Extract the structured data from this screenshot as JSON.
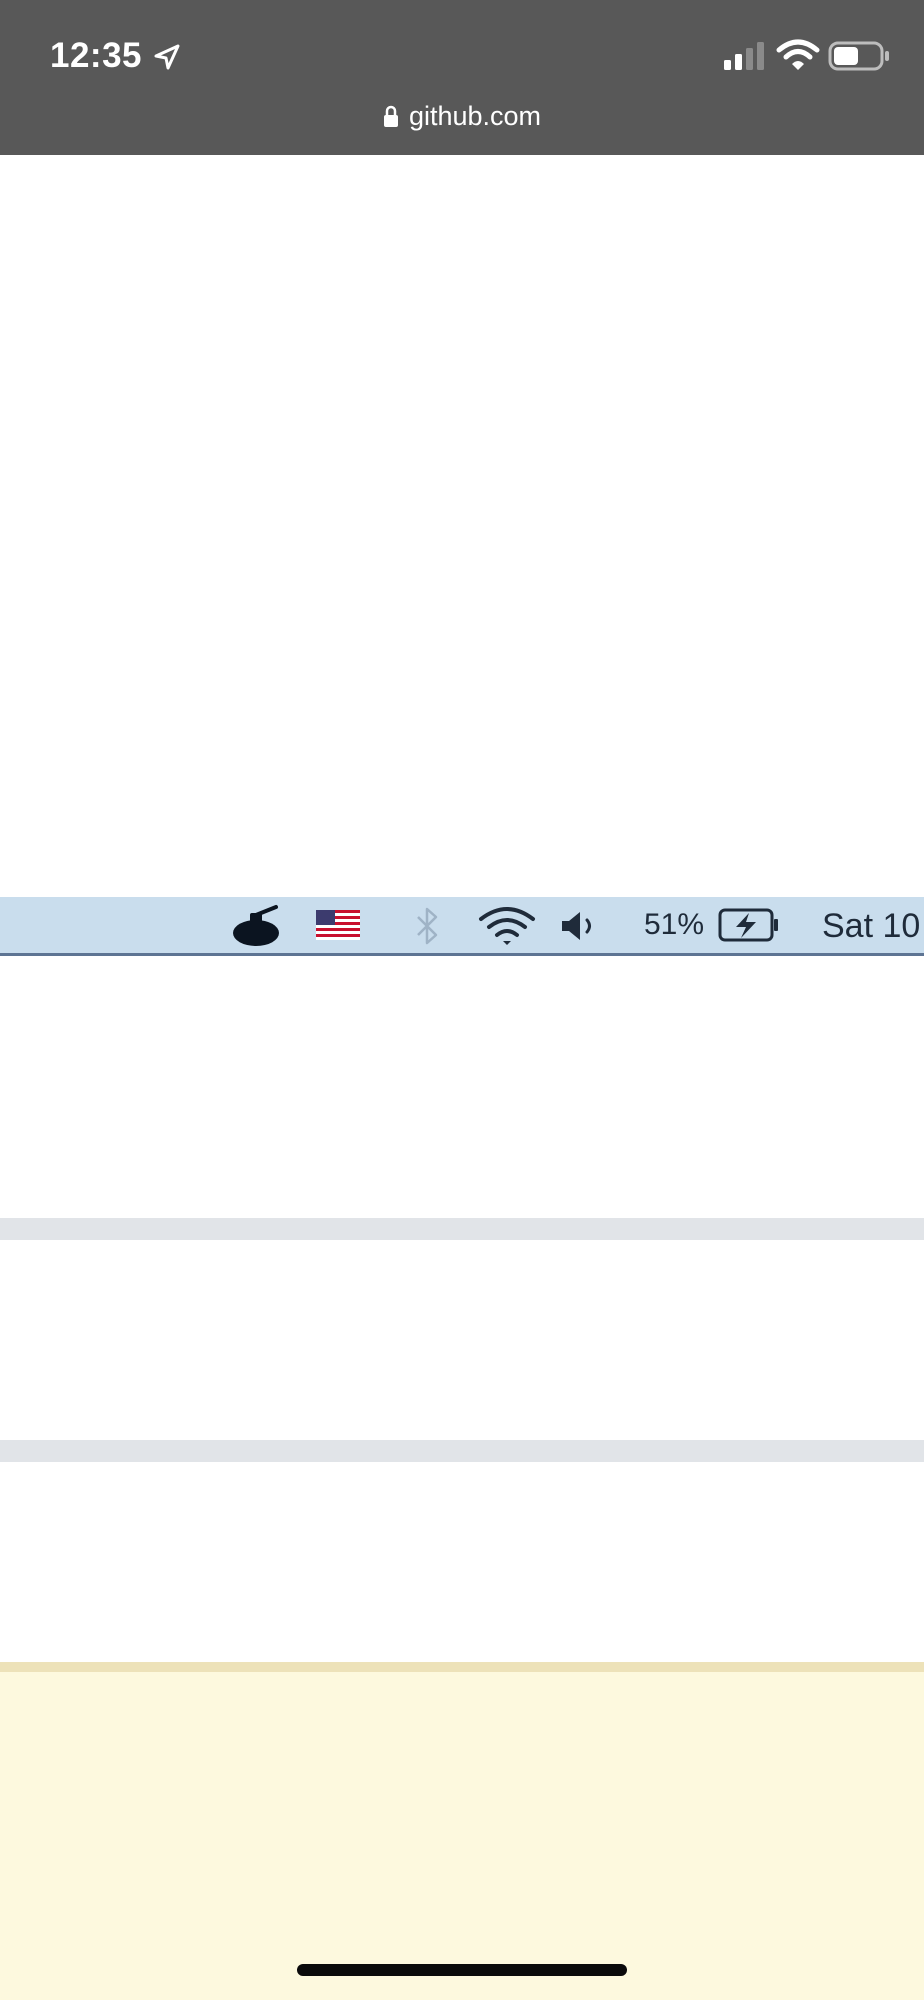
{
  "status_bar": {
    "time": "12:35",
    "icons": [
      "location-arrow-icon",
      "cellular-signal-icon",
      "wifi-icon",
      "battery-icon"
    ]
  },
  "browser": {
    "url": "github.com",
    "icons": [
      "lock-icon"
    ]
  },
  "mac_menubar": {
    "icons": [
      "app-icon",
      "us-flag-icon",
      "bluetooth-icon",
      "wifi-icon",
      "volume-icon",
      "battery-charging-icon"
    ],
    "battery_percent": "51%",
    "date_text": "Sat 10"
  },
  "colors": {
    "ios_bar": "#585858",
    "menubar_bg": "#c9dded",
    "divider": "#e1e4e8",
    "note_bg": "#fdf9de",
    "note_border": "#ede2b9"
  }
}
